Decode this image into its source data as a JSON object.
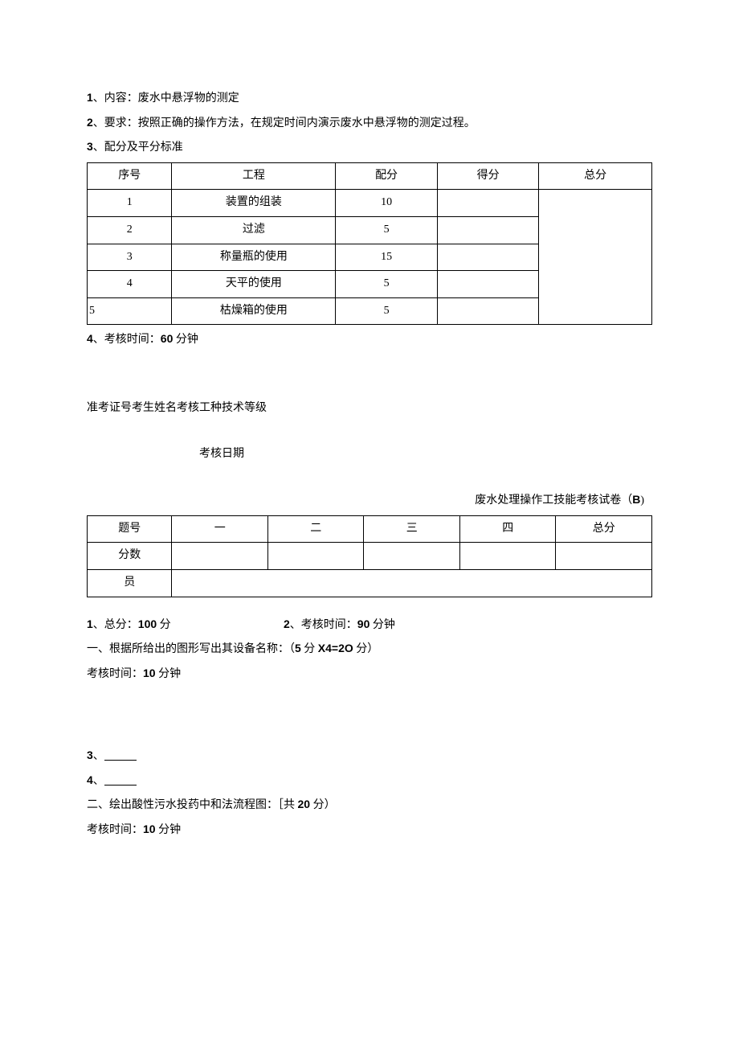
{
  "top": {
    "l1a": "1",
    "l1b": "、内容：废水中悬浮物的测定",
    "l2a": "2",
    "l2b": "、要求：按照正确的操作方法，在规定时间内演示废水中悬浮物的测定过程。",
    "l3a": "3",
    "l3b": "、配分及平分标准"
  },
  "table1": {
    "h1": "序号",
    "h2": "工程",
    "h3": "配分",
    "h4": "得分",
    "h5": "总分",
    "rows": [
      {
        "n": "1",
        "proj": "装置的组装",
        "score": "10"
      },
      {
        "n": "2",
        "proj": "过滤",
        "score": "5"
      },
      {
        "n": "3",
        "proj": "称量瓶的使用",
        "score": "15"
      },
      {
        "n": "4",
        "proj": "天平的使用",
        "score": "5"
      },
      {
        "n": "5",
        "proj": "枯燥箱的使用",
        "score": "5"
      }
    ]
  },
  "time1a": "4",
  "time1b": "、考核时间：",
  "time1c": "60",
  "time1d": " 分钟",
  "mid": {
    "info": "准考证号考生姓名考核工种技术等级",
    "date": "考核日期"
  },
  "title2a": "废水处理操作工技能考核试卷（",
  "title2b": "B",
  "title2c": ")",
  "table2": {
    "h1": "题号",
    "h2": "一",
    "h3": "二",
    "h4": "三",
    "h5": "四",
    "h6": "总分",
    "r2": "分数",
    "r3": "员"
  },
  "bottom": {
    "l1a": "1",
    "l1b": "、总分：",
    "l1c": "100",
    "l1d": " 分",
    "l1e": "2",
    "l1f": "、考核时间：",
    "l1g": "90",
    "l1h": " 分钟",
    "l2a": "一、根据所给出的图形写出其设备名称：（",
    "l2b": "5",
    "l2c": " 分 ",
    "l2d": "X4=2O",
    "l2e": " 分）",
    "l3a": "考核时间：",
    "l3b": "10",
    "l3c": " 分钟",
    "l4a": "3",
    "l4b": "、",
    "l5a": "4",
    "l5b": "、",
    "l6a": "二、绘出酸性污水投药中和法流程图：［共 ",
    "l6b": "20",
    "l6c": " 分）",
    "l7a": "考核时间：",
    "l7b": "10",
    "l7c": " 分钟"
  }
}
